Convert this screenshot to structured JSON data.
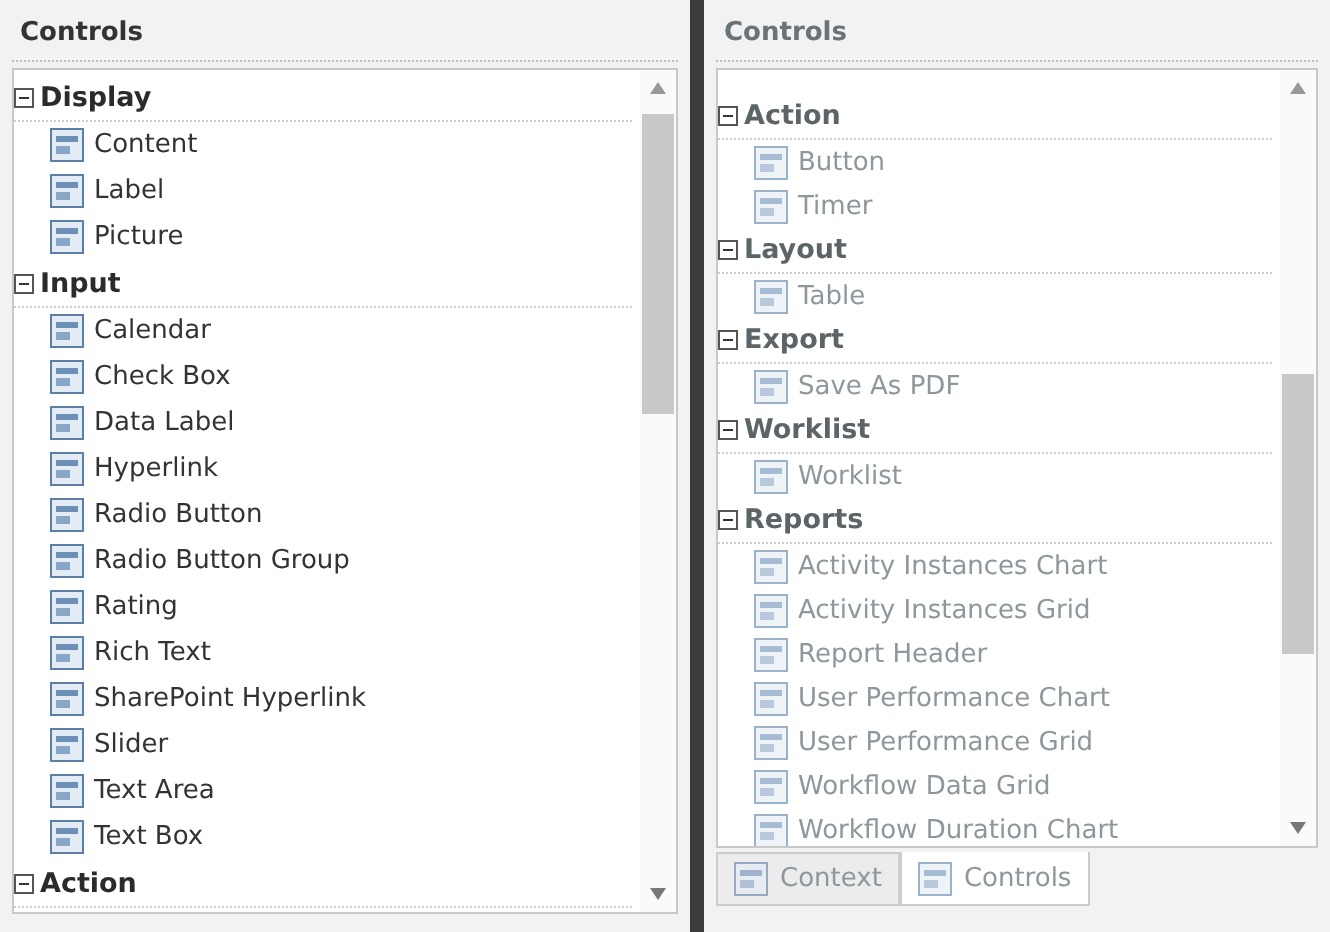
{
  "left_panel": {
    "title": "Controls",
    "groups": [
      {
        "label": "Display",
        "expanded": true,
        "children": [
          {
            "label": "Content"
          },
          {
            "label": "Label"
          },
          {
            "label": "Picture"
          }
        ]
      },
      {
        "label": "Input",
        "expanded": true,
        "children": [
          {
            "label": "Calendar"
          },
          {
            "label": "Check Box"
          },
          {
            "label": "Data Label"
          },
          {
            "label": "Hyperlink"
          },
          {
            "label": "Radio Button"
          },
          {
            "label": "Radio Button Group"
          },
          {
            "label": "Rating"
          },
          {
            "label": "Rich Text"
          },
          {
            "label": "SharePoint Hyperlink"
          },
          {
            "label": "Slider"
          },
          {
            "label": "Text Area"
          },
          {
            "label": "Text Box"
          }
        ]
      },
      {
        "label": "Action",
        "expanded": true
      }
    ]
  },
  "right_panel": {
    "title": "Controls",
    "groups": [
      {
        "label": "Action",
        "expanded": true,
        "children": [
          {
            "label": "Button"
          },
          {
            "label": "Timer"
          }
        ]
      },
      {
        "label": "Layout",
        "expanded": true,
        "children": [
          {
            "label": "Table"
          }
        ]
      },
      {
        "label": "Export",
        "expanded": true,
        "children": [
          {
            "label": "Save As PDF"
          }
        ]
      },
      {
        "label": "Worklist",
        "expanded": true,
        "children": [
          {
            "label": "Worklist"
          }
        ]
      },
      {
        "label": "Reports",
        "expanded": true,
        "children": [
          {
            "label": "Activity Instances Chart"
          },
          {
            "label": "Activity Instances Grid"
          },
          {
            "label": "Report Header"
          },
          {
            "label": "User Performance Chart"
          },
          {
            "label": "User Performance Grid"
          },
          {
            "label": "Workflow Data Grid"
          },
          {
            "label": "Workflow Duration Chart"
          }
        ]
      }
    ],
    "tabs": [
      {
        "label": "Context",
        "selected": false
      },
      {
        "label": "Controls",
        "selected": true
      }
    ]
  }
}
